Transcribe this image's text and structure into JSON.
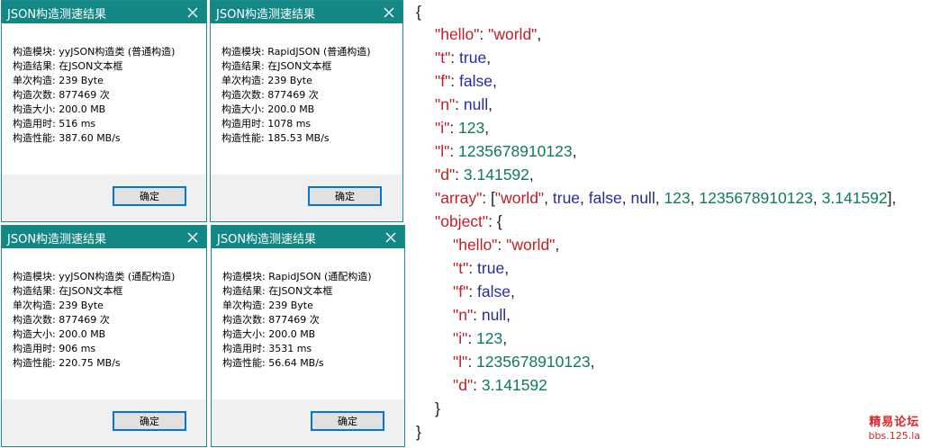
{
  "dialogs": [
    {
      "title": "JSON构造测速结果",
      "lines": [
        "构造模块: yyJSON构造类 (普通构造)",
        "构造结果: 在JSON文本框",
        "单次构造: 239 Byte",
        "构造次数: 877469 次",
        "构造大小: 200.0 MB",
        "构造用时: 516 ms",
        "构造性能: 387.60 MB/s"
      ],
      "ok_label": "确定"
    },
    {
      "title": "JSON构造测速结果",
      "lines": [
        "构造模块: RapidJSON (普通构造)",
        "构造结果: 在JSON文本框",
        "单次构造: 239 Byte",
        "构造次数: 877469 次",
        "构造大小: 200.0 MB",
        "构造用时: 1078 ms",
        "构造性能: 185.53 MB/s"
      ],
      "ok_label": "确定"
    },
    {
      "title": "JSON构造测速结果",
      "lines": [
        "构造模块: yyJSON构造类 (通配构造)",
        "构造结果: 在JSON文本框",
        "单次构造: 239 Byte",
        "构造次数: 877469 次",
        "构造大小: 200.0 MB",
        "构造用时: 906 ms",
        "构造性能: 220.75 MB/s"
      ],
      "ok_label": "确定"
    },
    {
      "title": "JSON构造测速结果",
      "lines": [
        "构造模块: RapidJSON (通配构造)",
        "构造结果: 在JSON文本框",
        "单次构造: 239 Byte",
        "构造次数: 877469 次",
        "构造大小: 200.0 MB",
        "构造用时: 3531 ms",
        "构造性能: 56.64 MB/s"
      ],
      "ok_label": "确定"
    }
  ],
  "json_text": {
    "open": "{",
    "hello_k": "\"hello\"",
    "hello_v": "\"world\"",
    "t_k": "\"t\"",
    "t_v": "true",
    "f_k": "\"f\"",
    "f_v": "false",
    "n_k": "\"n\"",
    "n_v": "null",
    "i_k": "\"i\"",
    "i_v": "123",
    "l_k": "\"l\"",
    "l_v": "1235678910123",
    "d_k": "\"d\"",
    "d_v": "3.141592",
    "array_k": "\"array\"",
    "arr_world": "\"world\"",
    "arr_true": "true",
    "arr_false": "false",
    "arr_null": "null",
    "arr_123": "123",
    "arr_l": "1235678910123",
    "arr_d": "3.141592",
    "object_k": "\"object\"",
    "o_hello_k": "\"hello\"",
    "o_hello_v": "\"world\"",
    "o_t_k": "\"t\"",
    "o_t_v": "true",
    "o_f_k": "\"f\"",
    "o_f_v": "false",
    "o_n_k": "\"n\"",
    "o_n_v": "null",
    "o_i_k": "\"i\"",
    "o_i_v": "123",
    "o_l_k": "\"l\"",
    "o_l_v": "1235678910123",
    "o_d_k": "\"d\"",
    "o_d_v": "3.141592",
    "inner_close": "}",
    "close": "}"
  },
  "watermark": {
    "line1": "精易论坛",
    "line2": "bbs.125.la"
  },
  "colors": {
    "titlebar": "#128783",
    "key": "#c21d27",
    "keyword": "#2a2aa0",
    "number": "#0f7a5c",
    "button_border": "#0078d7"
  },
  "icons": {
    "close": "close-icon"
  }
}
